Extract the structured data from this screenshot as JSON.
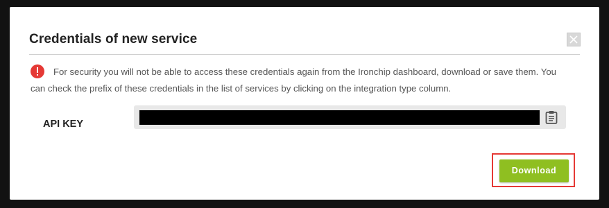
{
  "modal": {
    "title": "Credentials of new service",
    "notice": "For security you will not be able to access these credentials again from the Ironchip dashboard, download or save them. You can check the prefix of these credentials in the list of services by clicking on the integration type column.",
    "api_key_label": "API KEY",
    "api_key_value": "",
    "download_label": "Download"
  },
  "icons": {
    "close": "close-icon",
    "notice": "error-info-icon",
    "copy": "clipboard-icon"
  },
  "colors": {
    "primary_button": "#8fbf21",
    "notice_icon": "#e53935",
    "highlight": "#e53935",
    "key_field_bg": "#e8e8e8"
  }
}
